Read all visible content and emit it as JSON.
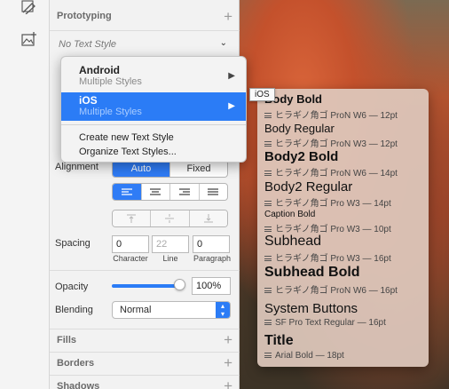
{
  "inspector": {
    "prototyping_label": "Prototyping",
    "text_style_value": "No Text Style",
    "alignment_label": "Alignment",
    "alignment_modes": [
      "Auto",
      "Fixed"
    ],
    "spacing_label": "Spacing",
    "spacing_values": {
      "character": "0",
      "line": "22",
      "paragraph": "0"
    },
    "spacing_captions": {
      "character": "Character",
      "line": "Line",
      "paragraph": "Paragraph"
    },
    "opacity_label": "Opacity",
    "opacity_value": "100%",
    "opacity_level": 1.0,
    "blending_label": "Blending",
    "blending_value": "Normal",
    "sections": [
      "Fills",
      "Borders",
      "Shadows"
    ]
  },
  "menu": {
    "android_title": "Android",
    "android_sub": "Multiple Styles",
    "ios_title": "iOS",
    "ios_sub": "Multiple Styles",
    "create": "Create new Text Style",
    "organize": "Organize Text Styles..."
  },
  "tooltip": "iOS",
  "text_styles": [
    {
      "name": "Body Bold",
      "desc": "ヒラギノ角ゴ ProN W6 — 12pt"
    },
    {
      "name": "Body Regular",
      "desc": "ヒラギノ角ゴ ProN W3 — 12pt"
    },
    {
      "name": "Body2 Bold",
      "desc": "ヒラギノ角ゴ ProN W6 — 14pt"
    },
    {
      "name": "Body2 Regular",
      "desc": "ヒラギノ角ゴ Pro W3 — 14pt"
    },
    {
      "name": "Caption Bold",
      "desc": "ヒラギノ角ゴ Pro W3 — 10pt"
    },
    {
      "name": "Subhead",
      "desc": "ヒラギノ角ゴ Pro W3 — 16pt"
    },
    {
      "name": "Subhead Bold",
      "desc": "ヒラギノ角ゴ ProN W6 — 16pt"
    },
    {
      "name": "System Buttons",
      "desc": "SF Pro Text Regular — 16pt"
    },
    {
      "name": "Title",
      "desc": "Arial Bold — 18pt"
    }
  ],
  "colors": {
    "accent": "#2b7cf6"
  }
}
